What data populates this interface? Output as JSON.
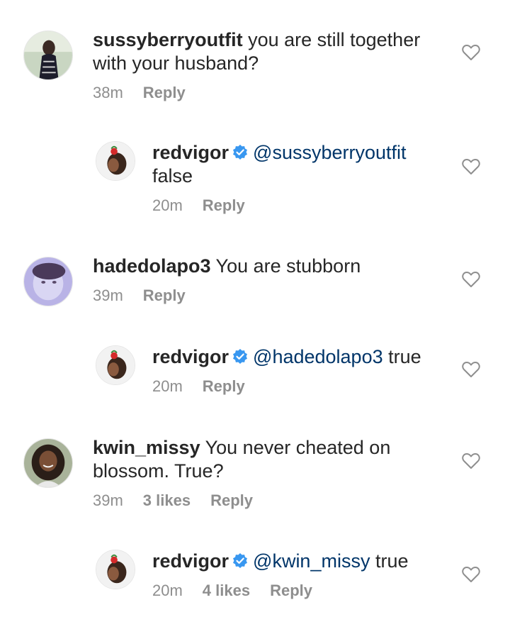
{
  "comments": [
    {
      "username": "sussyberryoutfit",
      "mention": "",
      "text": "you are still together with your husband?",
      "time": "38m",
      "likes": "",
      "reply_label": "Reply"
    },
    {
      "username": "redvigor",
      "mention": "@sussyberryoutfit",
      "text": "false",
      "time": "20m",
      "likes": "",
      "reply_label": "Reply"
    },
    {
      "username": "hadedolapo3",
      "mention": "",
      "text": "You are stubborn",
      "time": "39m",
      "likes": "",
      "reply_label": "Reply"
    },
    {
      "username": "redvigor",
      "mention": "@hadedolapo3",
      "text": "true",
      "time": "20m",
      "likes": "",
      "reply_label": "Reply"
    },
    {
      "username": "kwin_missy",
      "mention": "",
      "text": "You never cheated on blossom. True?",
      "time": "39m",
      "likes": "3 likes",
      "reply_label": "Reply"
    },
    {
      "username": "redvigor",
      "mention": "@kwin_missy",
      "text": "true",
      "time": "20m",
      "likes": "4 likes",
      "reply_label": "Reply"
    }
  ],
  "icons": {
    "like": "heart-outline-icon",
    "verified": "verified-badge-icon"
  },
  "colors": {
    "text": "#262626",
    "meta": "#8e8e8e",
    "mention": "#003569",
    "verified": "#3897f0"
  }
}
